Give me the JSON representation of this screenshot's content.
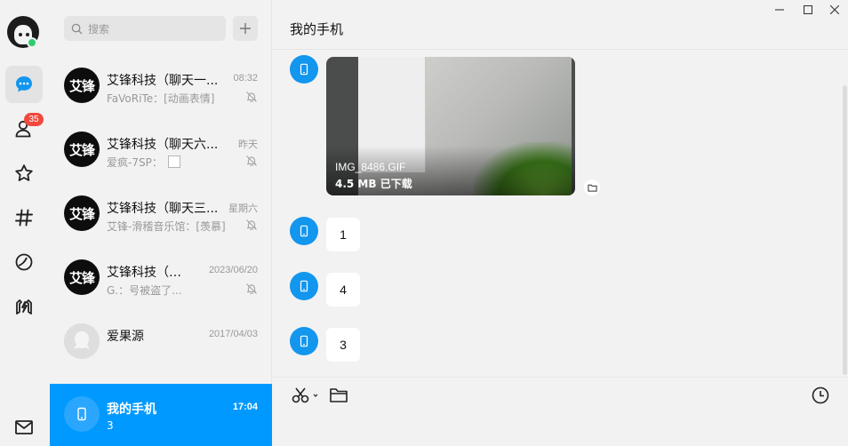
{
  "app": {
    "accent": "#0099ff"
  },
  "rail": {
    "items": [
      {
        "name": "message-icon",
        "active": true
      },
      {
        "name": "contacts-icon",
        "badge": "35"
      },
      {
        "name": "star-icon"
      },
      {
        "name": "hashtag-icon"
      },
      {
        "name": "planet-icon"
      },
      {
        "name": "games-icon"
      },
      {
        "name": "mail-icon"
      }
    ]
  },
  "search": {
    "placeholder": "搜索"
  },
  "conversations": [
    {
      "avatar_text": "艾锋",
      "name": "艾锋科技（聊天一...",
      "time": "08:32",
      "preview": "FaVoRiTe：[动画表情]",
      "muted": true
    },
    {
      "avatar_text": "艾锋",
      "name": "艾锋科技（聊天六...",
      "time": "昨天",
      "preview": "爱疯-7SP：",
      "muted": true
    },
    {
      "avatar_text": "艾锋",
      "name": "艾锋科技（聊天三...",
      "time": "星期六",
      "preview": "艾锋-滑稽音乐馆：[羡慕]",
      "muted": true
    },
    {
      "avatar_text": "艾锋",
      "name": "艾锋科技（聊...",
      "time": "2023/06/20",
      "preview": "G.：号被盗了...",
      "muted": true
    },
    {
      "avatar_text": "",
      "name": "爱果源",
      "time": "2017/04/03",
      "preview": "",
      "muted": false
    },
    {
      "avatar_text": "",
      "name": "我的手机",
      "time": "17:04",
      "preview": "3",
      "muted": false,
      "active": true
    }
  ],
  "chat": {
    "title": "我的手机",
    "file_message": {
      "filename": "IMG_8486.GIF",
      "status": "4.5 MB 已下载"
    },
    "text_messages": [
      "1",
      "4",
      "3"
    ]
  },
  "toolbar": {
    "items": [
      "scissors-icon",
      "folder-icon",
      "history-icon"
    ]
  }
}
